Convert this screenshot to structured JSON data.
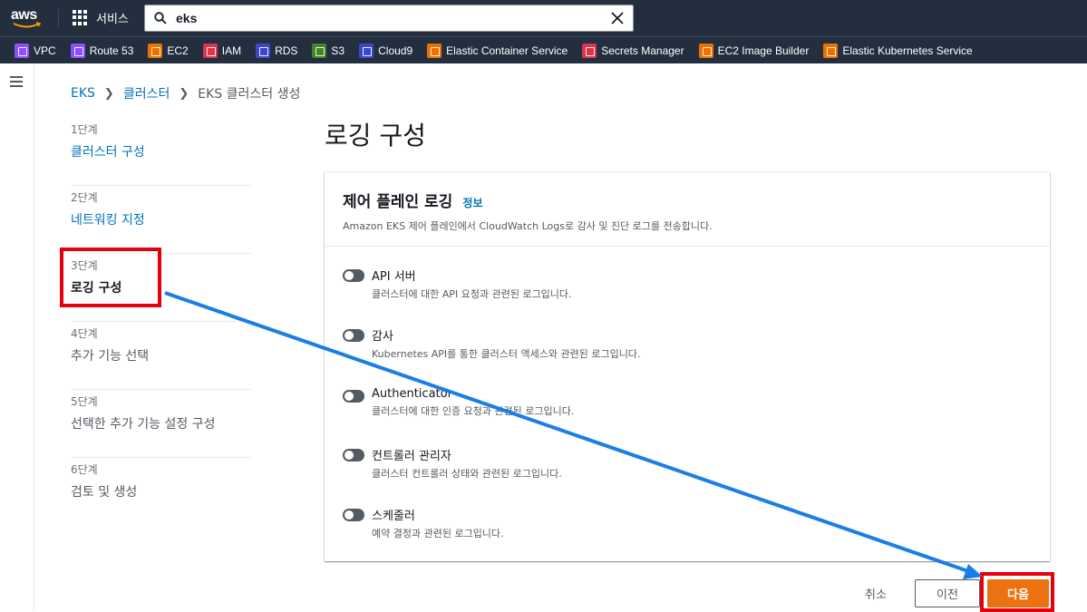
{
  "topbar": {
    "logo_text": "aws",
    "services_label": "서비스",
    "search_value": "eks"
  },
  "favorites": [
    {
      "label": "VPC",
      "color": "#8c4fff"
    },
    {
      "label": "Route 53",
      "color": "#8c4fff"
    },
    {
      "label": "EC2",
      "color": "#ed7100"
    },
    {
      "label": "IAM",
      "color": "#dd344c"
    },
    {
      "label": "RDS",
      "color": "#3b48cc"
    },
    {
      "label": "S3",
      "color": "#3f8624"
    },
    {
      "label": "Cloud9",
      "color": "#3b48cc"
    },
    {
      "label": "Elastic Container Service",
      "color": "#ed7100"
    },
    {
      "label": "Secrets Manager",
      "color": "#dd344c"
    },
    {
      "label": "EC2 Image Builder",
      "color": "#ed7100"
    },
    {
      "label": "Elastic Kubernetes Service",
      "color": "#ed7100"
    }
  ],
  "breadcrumb": {
    "items": [
      "EKS",
      "클러스터"
    ],
    "current": "EKS 클러스터 생성"
  },
  "steps": [
    {
      "num": "1단계",
      "label": "클러스터 구성"
    },
    {
      "num": "2단계",
      "label": "네트워킹 지정"
    },
    {
      "num": "3단계",
      "label": "로깅 구성"
    },
    {
      "num": "4단계",
      "label": "추가 기능 선택"
    },
    {
      "num": "5단계",
      "label": "선택한 추가 기능 설정 구성"
    },
    {
      "num": "6단계",
      "label": "검토 및 생성"
    }
  ],
  "page_title": "로깅 구성",
  "panel": {
    "title": "제어 플레인 로깅",
    "info_link": "정보",
    "description": "Amazon EKS 제어 플레인에서 CloudWatch Logs로 감사 및 진단 로그를 전송합니다.",
    "toggles": [
      {
        "title": "API 서버",
        "desc": "클러스터에 대한 API 요청과 관련된 로그입니다.",
        "on": false
      },
      {
        "title": "감사",
        "desc": "Kubernetes API를 통한 클러스터 액세스와 관련된 로그입니다.",
        "on": false
      },
      {
        "title": "Authenticator",
        "desc": "클러스터에 대한 인증 요청과 관련된 로그입니다.",
        "on": false
      },
      {
        "title": "컨트롤러 관리자",
        "desc": "클러스터 컨트롤러 상태와 관련된 로그입니다.",
        "on": false
      },
      {
        "title": "스케줄러",
        "desc": "예약 결정과 관련된 로그입니다.",
        "on": false
      }
    ]
  },
  "actions": {
    "cancel": "취소",
    "previous": "이전",
    "next": "다음"
  },
  "colors": {
    "header_bg": "#232f3e",
    "link": "#0073bb",
    "primary_button": "#ec7211",
    "highlight": "#e5000e",
    "arrow": "#1a7ee6"
  }
}
